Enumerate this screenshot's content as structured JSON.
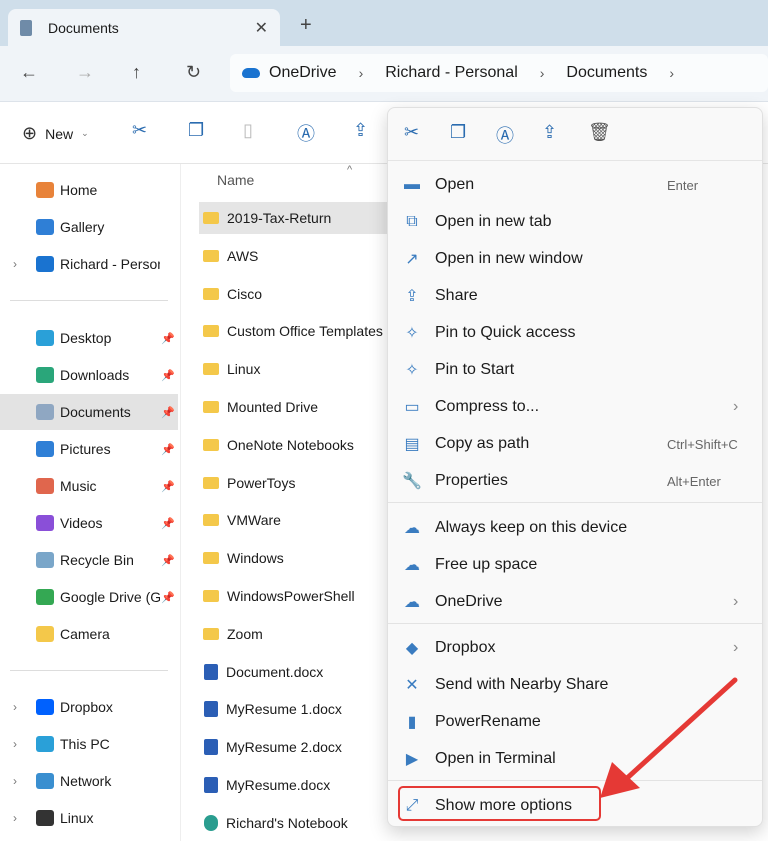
{
  "tab": {
    "title": "Documents",
    "close": "✕",
    "new_tab": "+"
  },
  "nav": {
    "back": "←",
    "forward": "→",
    "up": "↑",
    "refresh": "↻"
  },
  "breadcrumb": [
    "OneDrive",
    "Richard - Personal",
    "Documents"
  ],
  "toolbar": {
    "new_label": "New"
  },
  "sidebar": {
    "top": [
      {
        "label": "Home",
        "color": "#e8833a"
      },
      {
        "label": "Gallery",
        "color": "#2f7fd6"
      },
      {
        "label": "Richard - Personal",
        "color": "#1a73d0",
        "expand": true
      }
    ],
    "pinned": [
      {
        "label": "Desktop",
        "color": "#2aa0d8"
      },
      {
        "label": "Downloads",
        "color": "#2aa67a"
      },
      {
        "label": "Documents",
        "color": "#8fa7c2",
        "selected": true
      },
      {
        "label": "Pictures",
        "color": "#2f7fd6"
      },
      {
        "label": "Music",
        "color": "#e0664d"
      },
      {
        "label": "Videos",
        "color": "#8a4fd8"
      },
      {
        "label": "Recycle Bin",
        "color": "#7aa6c9"
      },
      {
        "label": "Google Drive (G",
        "color": "#34a853"
      },
      {
        "label": "Camera",
        "color": "#f4c84a",
        "nopin": true
      }
    ],
    "bottom": [
      {
        "label": "Dropbox",
        "color": "#0061fe"
      },
      {
        "label": "This PC",
        "color": "#2aa0d8"
      },
      {
        "label": "Network",
        "color": "#3a8fd0"
      },
      {
        "label": "Linux",
        "color": "#333"
      }
    ]
  },
  "files": {
    "column": "Name",
    "items": [
      {
        "name": "2019-Tax-Return",
        "type": "folder",
        "selected": true
      },
      {
        "name": "AWS",
        "type": "folder"
      },
      {
        "name": "Cisco",
        "type": "folder"
      },
      {
        "name": "Custom Office Templates",
        "type": "folder"
      },
      {
        "name": "Linux",
        "type": "folder"
      },
      {
        "name": "Mounted Drive",
        "type": "folder"
      },
      {
        "name": "OneNote Notebooks",
        "type": "folder"
      },
      {
        "name": "PowerToys",
        "type": "folder"
      },
      {
        "name": "VMWare",
        "type": "folder"
      },
      {
        "name": "Windows",
        "type": "folder"
      },
      {
        "name": "WindowsPowerShell",
        "type": "folder"
      },
      {
        "name": "Zoom",
        "type": "folder"
      },
      {
        "name": "Document.docx",
        "type": "word"
      },
      {
        "name": "MyResume 1.docx",
        "type": "word"
      },
      {
        "name": "MyResume 2.docx",
        "type": "word"
      },
      {
        "name": "MyResume.docx",
        "type": "word"
      },
      {
        "name": "Richard's Notebook",
        "type": "onenote"
      }
    ]
  },
  "context_menu": {
    "items": [
      {
        "label": "Open",
        "shortcut": "Enter",
        "icon": "▬"
      },
      {
        "label": "Open in new tab",
        "icon": "⧉"
      },
      {
        "label": "Open in new window",
        "icon": "↗"
      },
      {
        "label": "Share",
        "icon": "⇪"
      },
      {
        "label": "Pin to Quick access",
        "icon": "✧"
      },
      {
        "label": "Pin to Start",
        "icon": "✧"
      },
      {
        "label": "Compress to...",
        "icon": "▭",
        "submenu": true
      },
      {
        "label": "Copy as path",
        "shortcut": "Ctrl+Shift+C",
        "icon": "▤"
      },
      {
        "label": "Properties",
        "shortcut": "Alt+Enter",
        "icon": "🔧"
      },
      {
        "label": "Always keep on this device",
        "icon": "☁"
      },
      {
        "label": "Free up space",
        "icon": "☁"
      },
      {
        "label": "OneDrive",
        "icon": "☁",
        "submenu": true
      },
      {
        "label": "Dropbox",
        "icon": "◆",
        "submenu": true
      },
      {
        "label": "Send with Nearby Share",
        "icon": "✕"
      },
      {
        "label": "PowerRename",
        "icon": "▮"
      },
      {
        "label": "Open in Terminal",
        "icon": "▶"
      },
      {
        "label": "Show more options",
        "icon": "⤢"
      }
    ]
  },
  "colors": {
    "highlight": "#e53935",
    "accent": "#2b6cb0"
  }
}
